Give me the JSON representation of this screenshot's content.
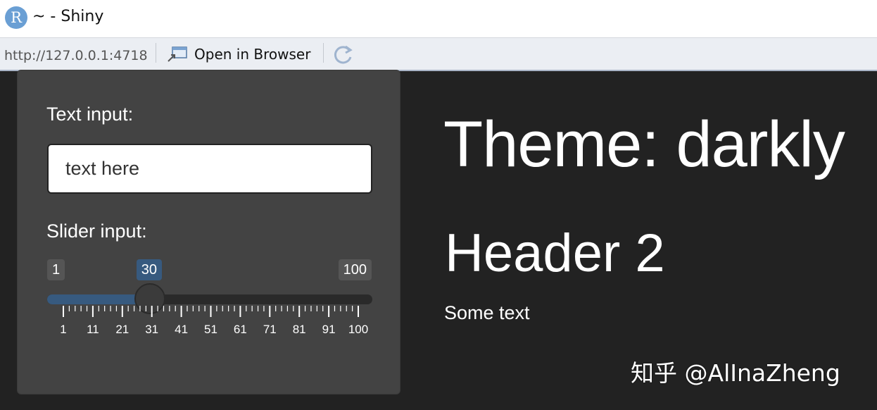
{
  "window": {
    "app_icon_letter": "R",
    "title": "~ - Shiny"
  },
  "toolbar": {
    "url": "http://127.0.0.1:4718",
    "open_in_browser_label": "Open in Browser",
    "icons": [
      "open-external-icon",
      "refresh-icon"
    ]
  },
  "sidebar": {
    "text_input_label": "Text input:",
    "text_input_value": "text here",
    "slider_label": "Slider input:",
    "slider": {
      "min": 1,
      "max": 100,
      "value": 30,
      "min_label": "1",
      "max_label": "100",
      "value_label": "30",
      "tick_labels": [
        "1",
        "11",
        "21",
        "31",
        "41",
        "51",
        "61",
        "71",
        "81",
        "91",
        "100"
      ]
    }
  },
  "main": {
    "heading1": "Theme: darkly",
    "heading2": "Header 2",
    "paragraph": "Some text"
  },
  "watermark": "知乎 @AlInaZheng",
  "colors": {
    "background": "#222222",
    "well": "#434343",
    "accent": "#375a7f",
    "badge_gray": "#555555"
  }
}
